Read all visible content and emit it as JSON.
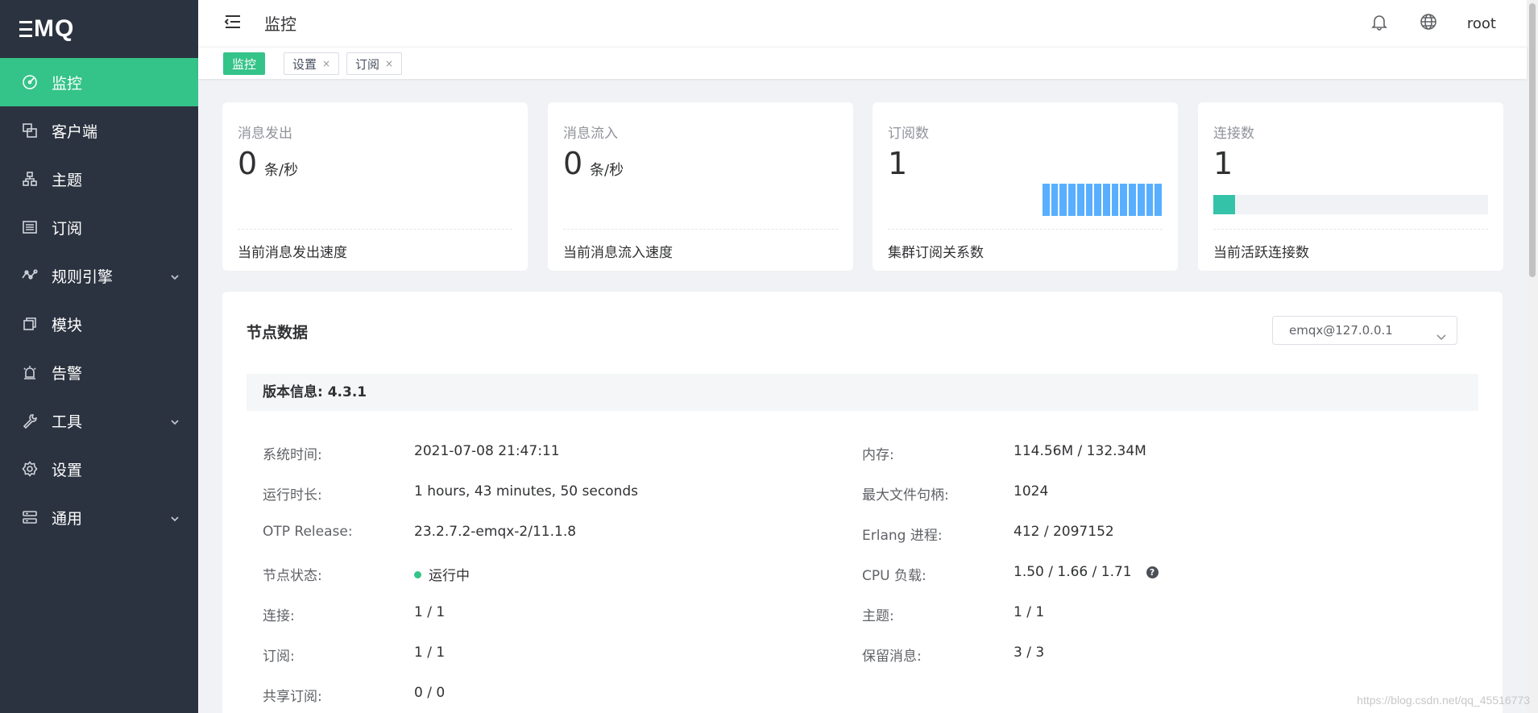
{
  "app": {
    "logo_text": "MQ"
  },
  "sidebar": {
    "items": [
      {
        "label": "监控",
        "icon": "dashboard-icon",
        "active": true,
        "expandable": false
      },
      {
        "label": "客户端",
        "icon": "clients-icon",
        "active": false,
        "expandable": false
      },
      {
        "label": "主题",
        "icon": "topics-icon",
        "active": false,
        "expandable": false
      },
      {
        "label": "订阅",
        "icon": "subscriptions-icon",
        "active": false,
        "expandable": false
      },
      {
        "label": "规则引擎",
        "icon": "rule-engine-icon",
        "active": false,
        "expandable": true
      },
      {
        "label": "模块",
        "icon": "modules-icon",
        "active": false,
        "expandable": false
      },
      {
        "label": "告警",
        "icon": "alarm-icon",
        "active": false,
        "expandable": false
      },
      {
        "label": "工具",
        "icon": "tools-icon",
        "active": false,
        "expandable": true
      },
      {
        "label": "设置",
        "icon": "settings-icon",
        "active": false,
        "expandable": false
      },
      {
        "label": "通用",
        "icon": "general-icon",
        "active": false,
        "expandable": true
      }
    ]
  },
  "header": {
    "title": "监控",
    "user": "root"
  },
  "tags": [
    {
      "label": "监控",
      "active": true,
      "closable": false
    },
    {
      "label": "设置",
      "active": false,
      "closable": true,
      "close_label": "×"
    },
    {
      "label": "订阅",
      "active": false,
      "closable": true,
      "close_label": "×"
    }
  ],
  "cards": [
    {
      "title": "消息发出",
      "value": "0",
      "unit": "条/秒",
      "desc": "当前消息发出速度"
    },
    {
      "title": "消息流入",
      "value": "0",
      "unit": "条/秒",
      "desc": "当前消息流入速度"
    },
    {
      "title": "订阅数",
      "value": "1",
      "unit": "",
      "desc": "集群订阅关系数",
      "bar_count": 14
    },
    {
      "title": "连接数",
      "value": "1",
      "unit": "",
      "desc": "当前活跃连接数",
      "progress_fraction": 0.08
    }
  ],
  "node": {
    "title": "节点数据",
    "selected_node": "emqx@127.0.0.1",
    "version": "版本信息: 4.3.1",
    "left": [
      {
        "key": "系统时间:",
        "value": "2021-07-08 21:47:11"
      },
      {
        "key": "运行时长:",
        "value": "1 hours, 43 minutes, 50 seconds"
      },
      {
        "key": "OTP Release:",
        "value": "23.2.7.2-emqx-2/11.1.8"
      },
      {
        "key": "节点状态:",
        "value": "运行中"
      },
      {
        "key": "连接:",
        "value": "1 / 1"
      },
      {
        "key": "订阅:",
        "value": "1 / 1"
      },
      {
        "key": "共享订阅:",
        "value": "0 / 0"
      }
    ],
    "right": [
      {
        "key": "内存:",
        "value": "114.56M / 132.34M"
      },
      {
        "key": "最大文件句柄:",
        "value": "1024"
      },
      {
        "key": "Erlang 进程:",
        "value": "412 / 2097152"
      },
      {
        "key": "CPU 负载:",
        "value": "1.50 / 1.66 / 1.71",
        "help": "?"
      },
      {
        "key": "主题:",
        "value": "1 / 1"
      },
      {
        "key": "保留消息:",
        "value": "3 / 3"
      }
    ]
  },
  "watermark": "https://blog.csdn.net/qq_45516773",
  "colors": {
    "sidebar_bg": "#2c3340",
    "accent": "#34c388",
    "bar_blue": "#58afff",
    "progress_teal": "#34c3a9"
  }
}
